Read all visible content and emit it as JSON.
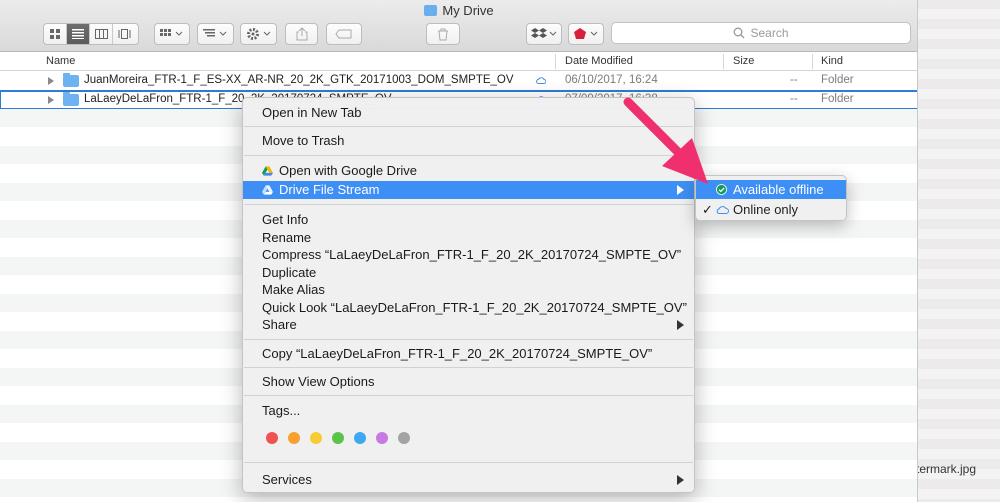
{
  "window": {
    "title": "My Drive"
  },
  "toolbar": {
    "search_placeholder": "Search",
    "icons": [
      "icon-view-icon",
      "list-view-icon",
      "column-view-icon",
      "coverflow-view-icon",
      "arrange-icon",
      "sort-icon",
      "gear-icon",
      "share-icon",
      "tag-icon",
      "trash-icon",
      "dropbox-icon",
      "gem-icon"
    ]
  },
  "columns": {
    "name": "Name",
    "date": "Date Modified",
    "size": "Size",
    "kind": "Kind"
  },
  "files": [
    {
      "name": "JuanMoreira_FTR-1_F_ES-XX_AR-NR_20_2K_GTK_20171003_DOM_SMPTE_OV",
      "date": "06/10/2017, 16:24",
      "size": "--",
      "kind": "Folder"
    },
    {
      "name": "LaLaeyDeLaFron_FTR-1_F_20_2K_20170724_SMPTE_OV",
      "date": "07/09/2017, 16:38",
      "size": "--",
      "kind": "Folder"
    }
  ],
  "menu": {
    "open_new_tab": "Open in New Tab",
    "move_to_trash": "Move to Trash",
    "open_google_drive": "Open with Google Drive",
    "drive_file_stream": "Drive File Stream",
    "get_info": "Get Info",
    "rename": "Rename",
    "compress": "Compress “LaLaeyDeLaFron_FTR-1_F_20_2K_20170724_SMPTE_OV”",
    "duplicate": "Duplicate",
    "make_alias": "Make Alias",
    "quick_look": "Quick Look “LaLaeyDeLaFron_FTR-1_F_20_2K_20170724_SMPTE_OV”",
    "share": "Share",
    "copy": "Copy “LaLaeyDeLaFron_FTR-1_F_20_2K_20170724_SMPTE_OV”",
    "show_view_options": "Show View Options",
    "tags": "Tags...",
    "services": "Services",
    "tag_colors": [
      "#f0524f",
      "#f7a02e",
      "#f5cc33",
      "#5cc34a",
      "#3fa8f0",
      "#c77ae0",
      "#a3a3a3"
    ]
  },
  "submenu": {
    "available_offline": "Available offline",
    "online_only": "Online only",
    "check_mark": "✓"
  },
  "desktop": {
    "file_label": "termark.jpg"
  },
  "colors": {
    "highlight": "#3e8ff5",
    "arrow": "#f0306e",
    "selection_outline": "#2f7bd9"
  }
}
